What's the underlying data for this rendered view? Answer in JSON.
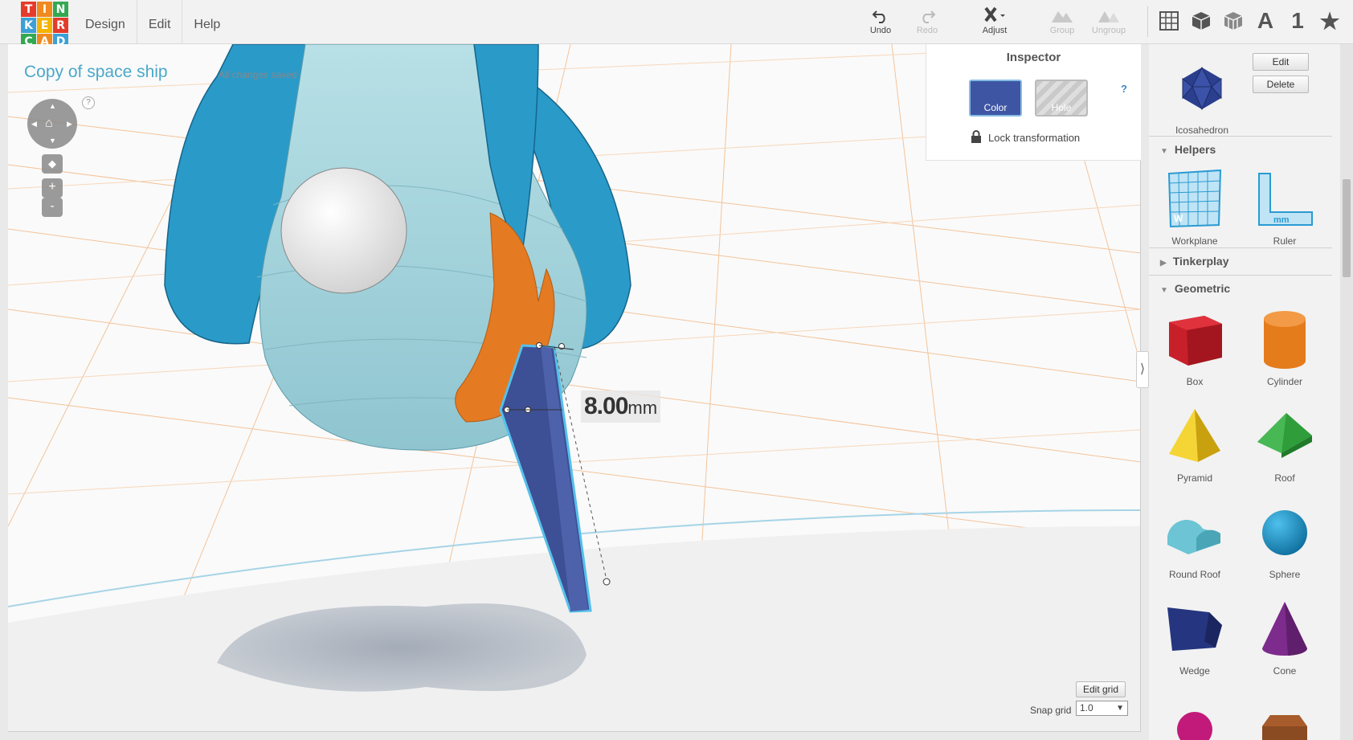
{
  "app": {
    "logo_letters": [
      "T",
      "I",
      "N",
      "K",
      "E",
      "R",
      "C",
      "A",
      "D"
    ],
    "logo_colors": [
      "#e53b2a",
      "#f08a1e",
      "#33a852",
      "#3ca0d6",
      "#f4b400",
      "#e53b2a",
      "#33a852",
      "#f08a1e",
      "#3ca0d6"
    ]
  },
  "menu": [
    {
      "label": "Design"
    },
    {
      "label": "Edit"
    },
    {
      "label": "Help"
    }
  ],
  "toolbar": {
    "undo": "Undo",
    "redo": "Redo",
    "adjust": "Adjust",
    "group": "Group",
    "ungroup": "Ungroup"
  },
  "view_icons": {
    "number_label": "1"
  },
  "design": {
    "title": "Copy of space ship",
    "save_status": "All changes saved"
  },
  "nav": {
    "help": "?",
    "zoom_in": "+",
    "zoom_out": "-"
  },
  "dimension": {
    "value": "8.00",
    "unit": "mm"
  },
  "inspector": {
    "title": "Inspector",
    "color_label": "Color",
    "hole_label": "Hole",
    "help": "?",
    "lock_label": "Lock transformation",
    "selected_color": "#3e55a3"
  },
  "grid": {
    "edit_grid": "Edit grid",
    "snap_label": "Snap grid",
    "snap_value": "1.0"
  },
  "sidebar": {
    "selected_shape": {
      "name": "Icosahedron",
      "edit": "Edit",
      "delete": "Delete"
    },
    "sections": [
      {
        "label": "Helpers",
        "expanded": true
      },
      {
        "label": "Tinkerplay",
        "expanded": false
      },
      {
        "label": "Geometric",
        "expanded": true
      }
    ],
    "helpers": [
      {
        "label": "Workplane",
        "icon": "workplane-icon",
        "badge": "W"
      },
      {
        "label": "Ruler",
        "icon": "ruler-icon",
        "badge": "mm"
      }
    ],
    "geometric": [
      {
        "label": "Box",
        "icon": "box-icon",
        "color": "#c8202a"
      },
      {
        "label": "Cylinder",
        "icon": "cylinder-icon",
        "color": "#e57c1c"
      },
      {
        "label": "Pyramid",
        "icon": "pyramid-icon",
        "color": "#e6c21a"
      },
      {
        "label": "Roof",
        "icon": "roof-icon",
        "color": "#2f9d3a"
      },
      {
        "label": "Round Roof",
        "icon": "round-roof-icon",
        "color": "#6cc4d4"
      },
      {
        "label": "Sphere",
        "icon": "sphere-icon",
        "color": "#1793cc"
      },
      {
        "label": "Wedge",
        "icon": "wedge-icon",
        "color": "#26357f"
      },
      {
        "label": "Cone",
        "icon": "cone-icon",
        "color": "#7d2b8c"
      }
    ]
  }
}
